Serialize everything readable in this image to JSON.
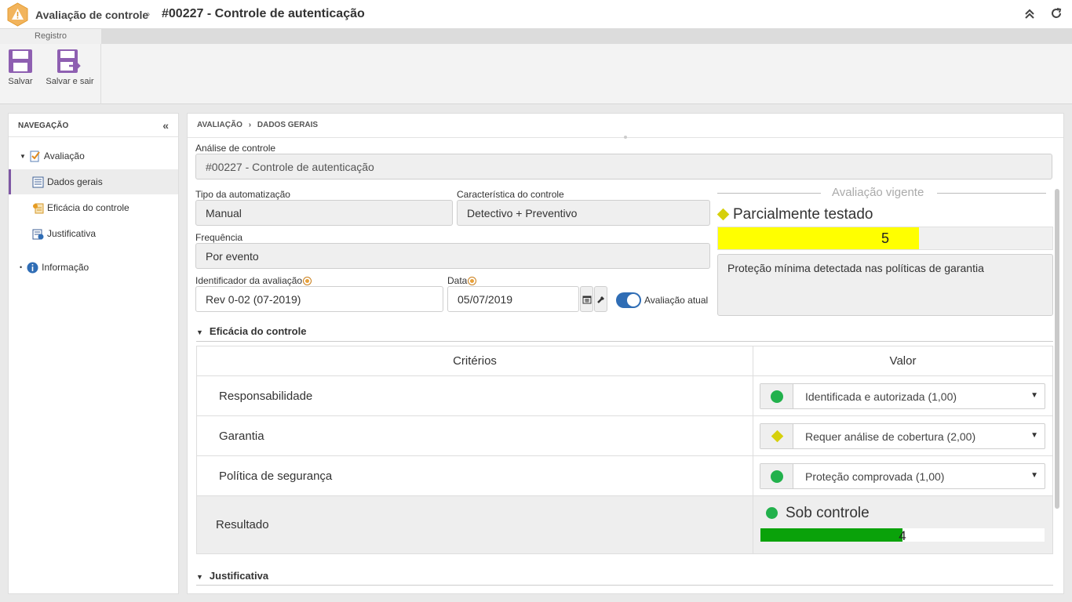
{
  "header": {
    "module": "Avaliação de controle",
    "separator": "›",
    "title": "#00227 - Controle de autenticação"
  },
  "ribbon": {
    "tab": "Registro",
    "save": "Salvar",
    "save_exit": "Salvar e sair"
  },
  "nav": {
    "title": "NAVEGAÇÃO",
    "items": [
      {
        "label": "Avaliação",
        "icon": "assessment-icon"
      },
      {
        "label": "Dados gerais",
        "icon": "list-icon"
      },
      {
        "label": "Eficácia do controle",
        "icon": "efficacy-icon"
      },
      {
        "label": "Justificativa",
        "icon": "justification-icon"
      },
      {
        "label": "Informação",
        "icon": "info-icon"
      }
    ]
  },
  "breadcrumb": {
    "part1": "AVALIAÇÃO",
    "sep": "›",
    "part2": "DADOS GERAIS"
  },
  "form": {
    "analysis_label": "Análise de controle",
    "analysis_value": "#00227 - Controle de autenticação",
    "automation_label": "Tipo da automatização",
    "automation_value": "Manual",
    "characteristic_label": "Característica do controle",
    "characteristic_value": "Detectivo + Preventivo",
    "frequency_label": "Frequência",
    "frequency_value": "Por evento",
    "id_label": "Identificador da avaliação",
    "id_value": "Rev 0-02 (07-2019)",
    "date_label": "Data",
    "date_value": "05/07/2019",
    "current_label": "Avaliação atual"
  },
  "current_assessment": {
    "title": "Avaliação vigente",
    "status": "Parcialmente testado",
    "score": "5",
    "score_fraction": 0.6,
    "bar_color": "#ffff00",
    "note": "Proteção mínima detectada nas políticas de garantia"
  },
  "efficacy": {
    "title": "Eficácia do controle",
    "col_criteria": "Critérios",
    "col_value": "Valor",
    "rows": [
      {
        "criterion": "Responsabilidade",
        "value": "Identificada e autorizada (1,00)",
        "icon": "green-circle"
      },
      {
        "criterion": "Garantia",
        "value": "Requer análise de cobertura (2,00)",
        "icon": "yellow-diamond"
      },
      {
        "criterion": "Política de segurança",
        "value": "Proteção comprovada (1,00)",
        "icon": "green-circle"
      }
    ],
    "result_label": "Resultado",
    "result_status": "Sob controle",
    "result_score": "4",
    "result_fraction": 0.5,
    "result_color": "#0aa20a"
  },
  "justification": {
    "title": "Justificativa"
  },
  "colors": {
    "accent": "#7e57a4",
    "green": "#22b14c",
    "yellow": "#d6d00c",
    "toggle": "#2f6db5"
  }
}
